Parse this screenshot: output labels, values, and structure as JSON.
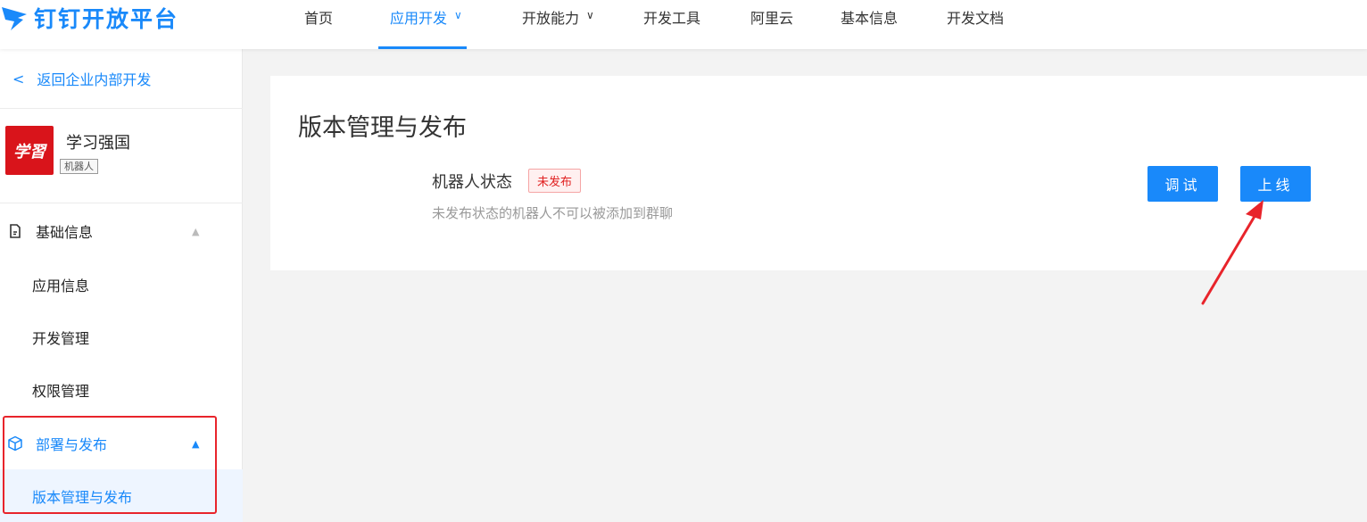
{
  "brand": {
    "name": "钉钉开放平台",
    "color": "#1989fa",
    "icon": "dingtalk-logo-icon"
  },
  "nav": {
    "items": [
      {
        "label": "首页"
      },
      {
        "label": "应用开发",
        "chevron": "∨"
      },
      {
        "label": "开放能力",
        "chevron": "∨"
      },
      {
        "label": "开发工具"
      },
      {
        "label": "阿里云"
      },
      {
        "label": "基本信息"
      },
      {
        "label": "开发文档"
      }
    ],
    "active": "应用开发"
  },
  "sidebar": {
    "back_link": "返回企业内部开发",
    "app": {
      "name": "学习强国",
      "tag": "机器人",
      "logo_text": "学習"
    },
    "groups": [
      {
        "label": "基础信息",
        "icon": "file-icon",
        "caret": "▲",
        "items": [
          "应用信息",
          "开发管理",
          "权限管理"
        ]
      },
      {
        "label": "部署与发布",
        "icon": "cube-icon",
        "caret": "▲",
        "active": true,
        "items": [
          "版本管理与发布"
        ]
      }
    ],
    "active_item": "版本管理与发布"
  },
  "main": {
    "title": "版本管理与发布",
    "status_label": "机器人状态",
    "status_badge": "未发布",
    "status_hint": "未发布状态的机器人不可以被添加到群聊",
    "buttons": {
      "debug": "调试",
      "publish": "上线"
    }
  },
  "annotations": {
    "highlight_color": "#e8242b"
  }
}
